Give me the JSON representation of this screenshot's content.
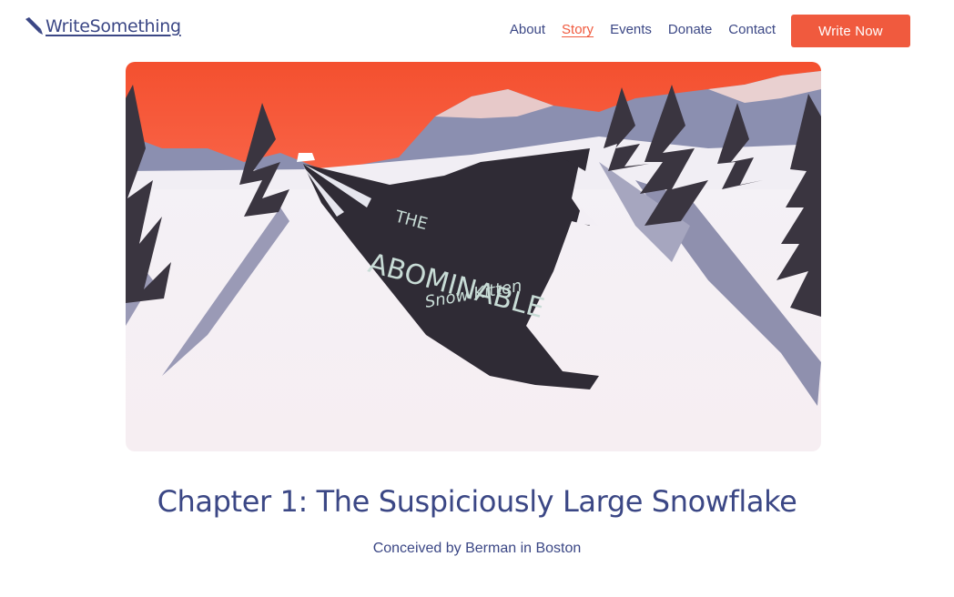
{
  "brand": {
    "name": "WriteSomething",
    "accent_color": "#f05a3e",
    "text_color": "#3b4785",
    "icon": "pen-icon"
  },
  "nav": {
    "items": [
      {
        "label": "About",
        "active": false
      },
      {
        "label": "Story",
        "active": true
      },
      {
        "label": "Events",
        "active": false
      },
      {
        "label": "Donate",
        "active": false
      },
      {
        "label": "Contact",
        "active": false
      }
    ],
    "cta_label": "Write Now"
  },
  "hero": {
    "artwork_title_line1": "THE",
    "artwork_title_line2": "ABOMINABLE",
    "artwork_title_line3": "Snow Kitten"
  },
  "story": {
    "chapter_title": "Chapter 1: The Suspiciously Large Snowflake",
    "byline": "Conceived by Berman in Boston"
  }
}
